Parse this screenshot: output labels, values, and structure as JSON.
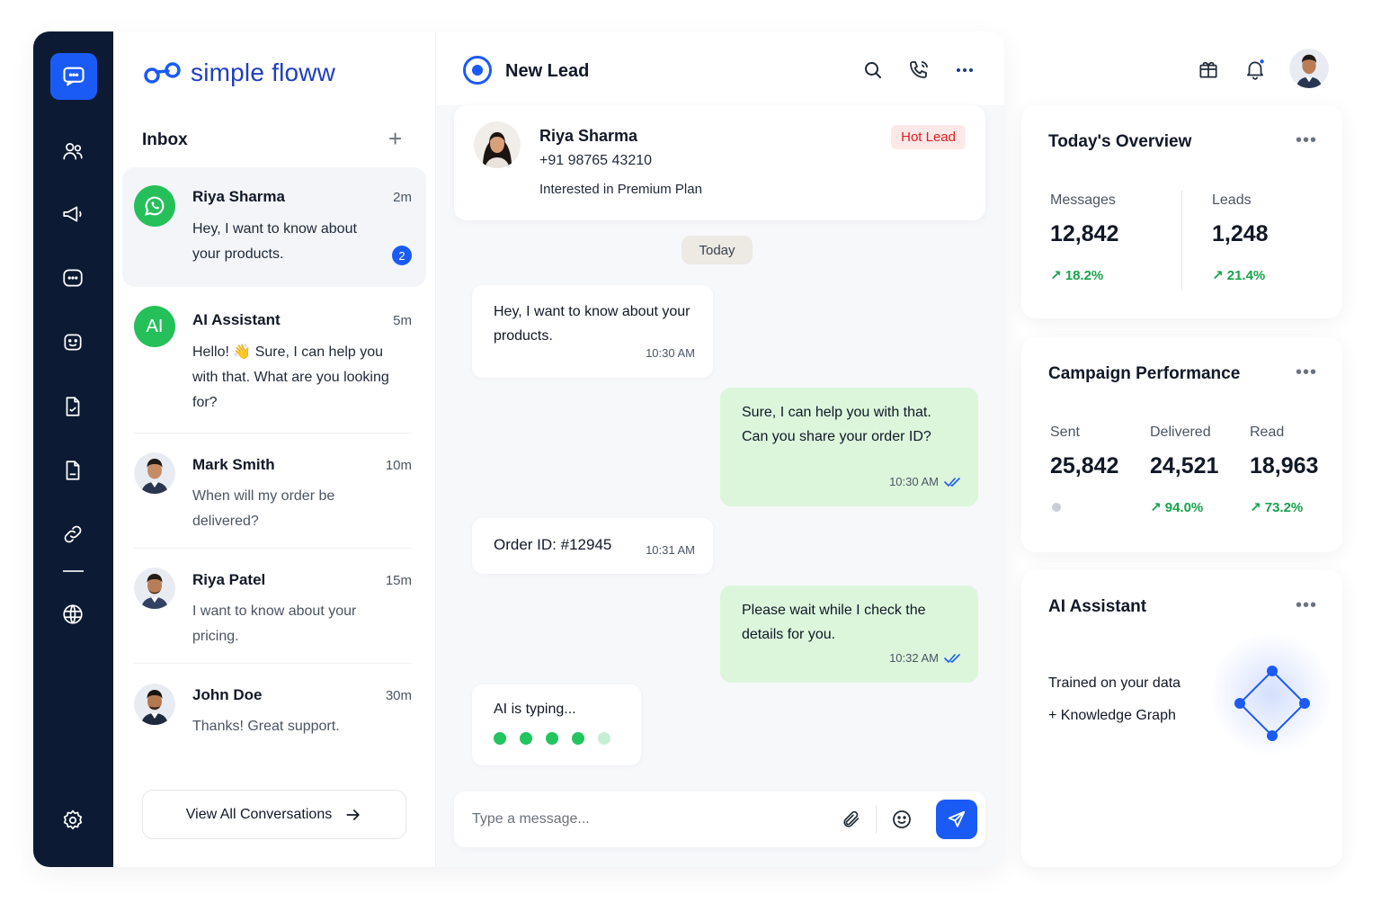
{
  "app": {
    "brand_name": "simple floww"
  },
  "rail": {
    "icons": [
      "chat-icon",
      "users-icon",
      "megaphone-icon",
      "message-dots-icon",
      "bot-icon",
      "document-icon",
      "file-icon",
      "link-icon",
      "globe-icon",
      "settings-icon"
    ]
  },
  "inbox": {
    "title": "Inbox",
    "add_label": "+",
    "conversations": [
      {
        "name": "Riya Sharma",
        "time": "2m",
        "message": "Hey, I want to know about your products.",
        "unread": "2",
        "channel": "whatsapp"
      },
      {
        "name": "AI Assistant",
        "time": "5m",
        "message": "Hello! 👋 Sure, I can help you with that. What are you looking for?",
        "initials": "AI"
      },
      {
        "name": "Mark Smith",
        "time": "10m",
        "message": "When will my order be delivered?"
      },
      {
        "name": "Riya Patel",
        "time": "15m",
        "message": "I want to know about your pricing."
      },
      {
        "name": "John Doe",
        "time": "30m",
        "message": "Thanks! Great support."
      }
    ],
    "view_all_label": "View All Conversations"
  },
  "chat": {
    "title": "New Lead",
    "contact": {
      "name": "Riya Sharma",
      "phone": "+91 98765 43210",
      "note": "Interested in Premium Plan",
      "badge": "Hot Lead"
    },
    "day_label": "Today",
    "messages": [
      {
        "direction": "in",
        "text": "Hey, I want to know about your products.",
        "time": "10:30 AM"
      },
      {
        "direction": "out",
        "text": "Sure, I can help you with that. Can you share your order ID?",
        "time": "10:30 AM"
      },
      {
        "direction": "in",
        "text": "Order ID: #12945",
        "time": "10:31 AM"
      },
      {
        "direction": "out",
        "text": "Please wait while I check the details for you.",
        "time": "10:32 AM"
      }
    ],
    "typing_label": "AI is typing...",
    "composer_placeholder": "Type a message..."
  },
  "overview": {
    "title": "Today's Overview",
    "stats": [
      {
        "label": "Messages",
        "value": "12,842",
        "trend": "↗ 18.2%"
      },
      {
        "label": "Leads",
        "value": "1,248",
        "trend": "↗ 21.4%"
      }
    ]
  },
  "campaign": {
    "title": "Campaign Performance",
    "stats": [
      {
        "label": "Sent",
        "value": "25,842"
      },
      {
        "label": "Delivered",
        "value": "24,521",
        "trend": "↗ 94.0%"
      },
      {
        "label": "Read",
        "value": "18,963",
        "trend": "↗ 73.2%"
      }
    ]
  },
  "assistant": {
    "title": "AI Assistant",
    "line1": "Trained on your data",
    "line2": "+ Knowledge Graph"
  },
  "colors": {
    "accent": "#1b5bf5",
    "rail": "#0c1a33",
    "success": "#16a34a",
    "danger": "#e11d1d",
    "out_bubble": "#dcf6dc"
  }
}
